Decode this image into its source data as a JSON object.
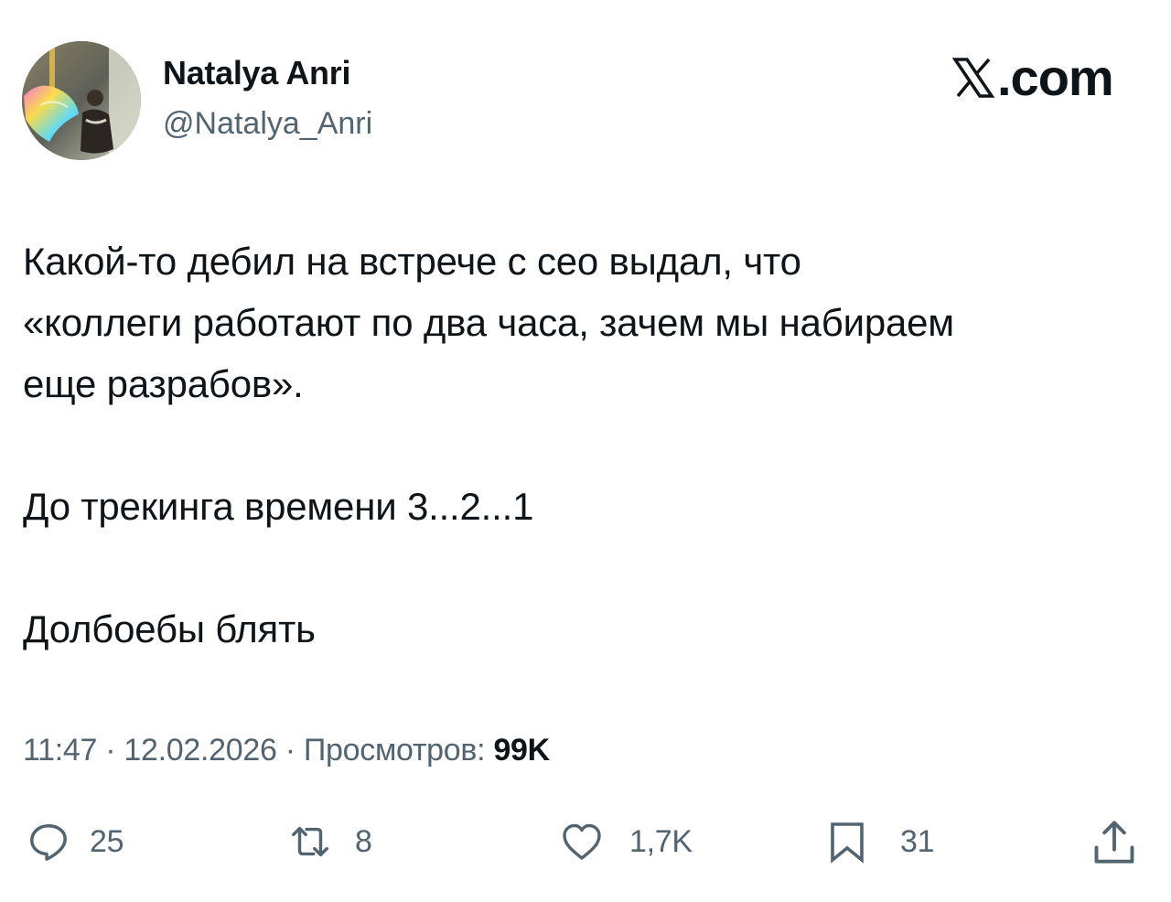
{
  "profile": {
    "display_name": "Natalya Anri",
    "handle": "@Natalya_Anri",
    "avatar_icon": "profile-photo"
  },
  "brand": {
    "icon": "x-logo-icon",
    "domain": ".com"
  },
  "tweet": {
    "paragraphs": [
      "Какой-то дебил на встрече с сео выдал, что",
      "«коллеги работают по два часа, зачем мы набираем",
      "еще разрабов».",
      "До трекинга времени 3...2...1",
      "Долбоебы блять"
    ]
  },
  "meta": {
    "time": "11:47",
    "separator": " · ",
    "date": "12.02.2026",
    "views_label": "Просмотров: ",
    "views_count": "99K"
  },
  "actions": {
    "reply": {
      "icon": "reply-icon",
      "count": "25"
    },
    "repost": {
      "icon": "repost-icon",
      "count": "8"
    },
    "like": {
      "icon": "heart-icon",
      "count": "1,7K"
    },
    "bookmark": {
      "icon": "bookmark-icon",
      "count": "31"
    },
    "share": {
      "icon": "share-icon"
    }
  },
  "colors": {
    "text": "#0f1419",
    "secondary": "#536471",
    "background": "#ffffff"
  }
}
